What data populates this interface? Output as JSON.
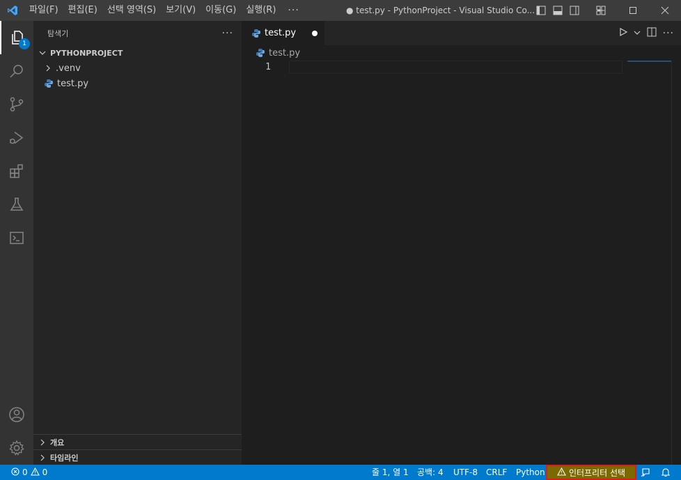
{
  "titlebar": {
    "menus": [
      "파일(F)",
      "편집(E)",
      "선택 영역(S)",
      "보기(V)",
      "이동(G)",
      "실행(R)"
    ],
    "more": "···",
    "window_title": "● test.py - PythonProject - Visual Studio Co..."
  },
  "activity": {
    "explorer_badge": "1"
  },
  "sidebar": {
    "header": "탐색기",
    "more": "···",
    "project": "PYTHONPROJECT",
    "items": [
      {
        "label": ".venv"
      },
      {
        "label": "test.py"
      }
    ],
    "outline": "개요",
    "timeline": "타임라인"
  },
  "editor": {
    "tab_label": "test.py",
    "breadcrumb": "test.py",
    "line_number": "1"
  },
  "status": {
    "errors": "0",
    "warnings": "0",
    "position": "줄 1, 열 1",
    "spaces": "공백: 4",
    "encoding": "UTF-8",
    "eol": "CRLF",
    "language": "Python",
    "interpreter": "인터프리터 선택"
  },
  "colors": {
    "accent": "#007acc",
    "interpreter_bg": "#7a6a00",
    "highlight_border": "#e01b1b"
  }
}
